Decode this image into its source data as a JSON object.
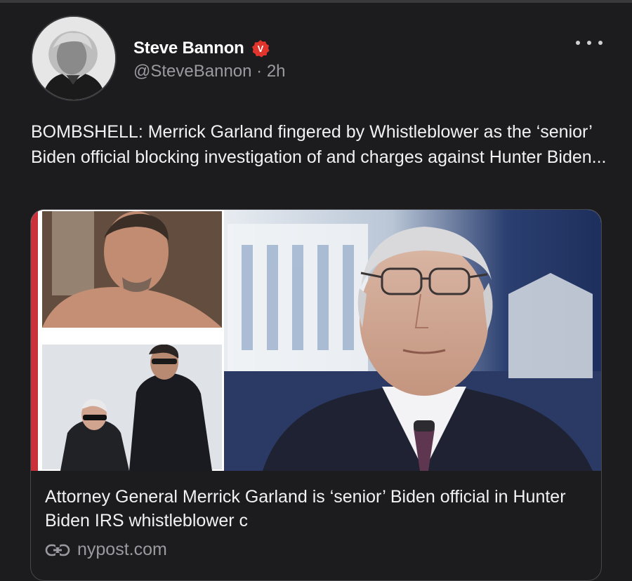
{
  "author": {
    "display_name": "Steve Bannon",
    "handle": "@SteveBannon",
    "separator": "·",
    "time": "2h",
    "verified_badge_letter": "V",
    "verified_color": "#e0342c"
  },
  "post": {
    "text": "BOMBSHELL: Merrick Garland fingered by Whistleblower as the ‘senior’ Biden official blocking investigation of and charges against Hunter Biden..."
  },
  "link_card": {
    "title": "Attorney General Merrick Garland is ‘senior’ Biden official in Hunter Biden IRS whistleblower c",
    "domain": "nypost.com",
    "link_icon": "link-icon"
  },
  "icons": {
    "more": "more-dots-icon",
    "verified": "verified-badge-icon"
  }
}
